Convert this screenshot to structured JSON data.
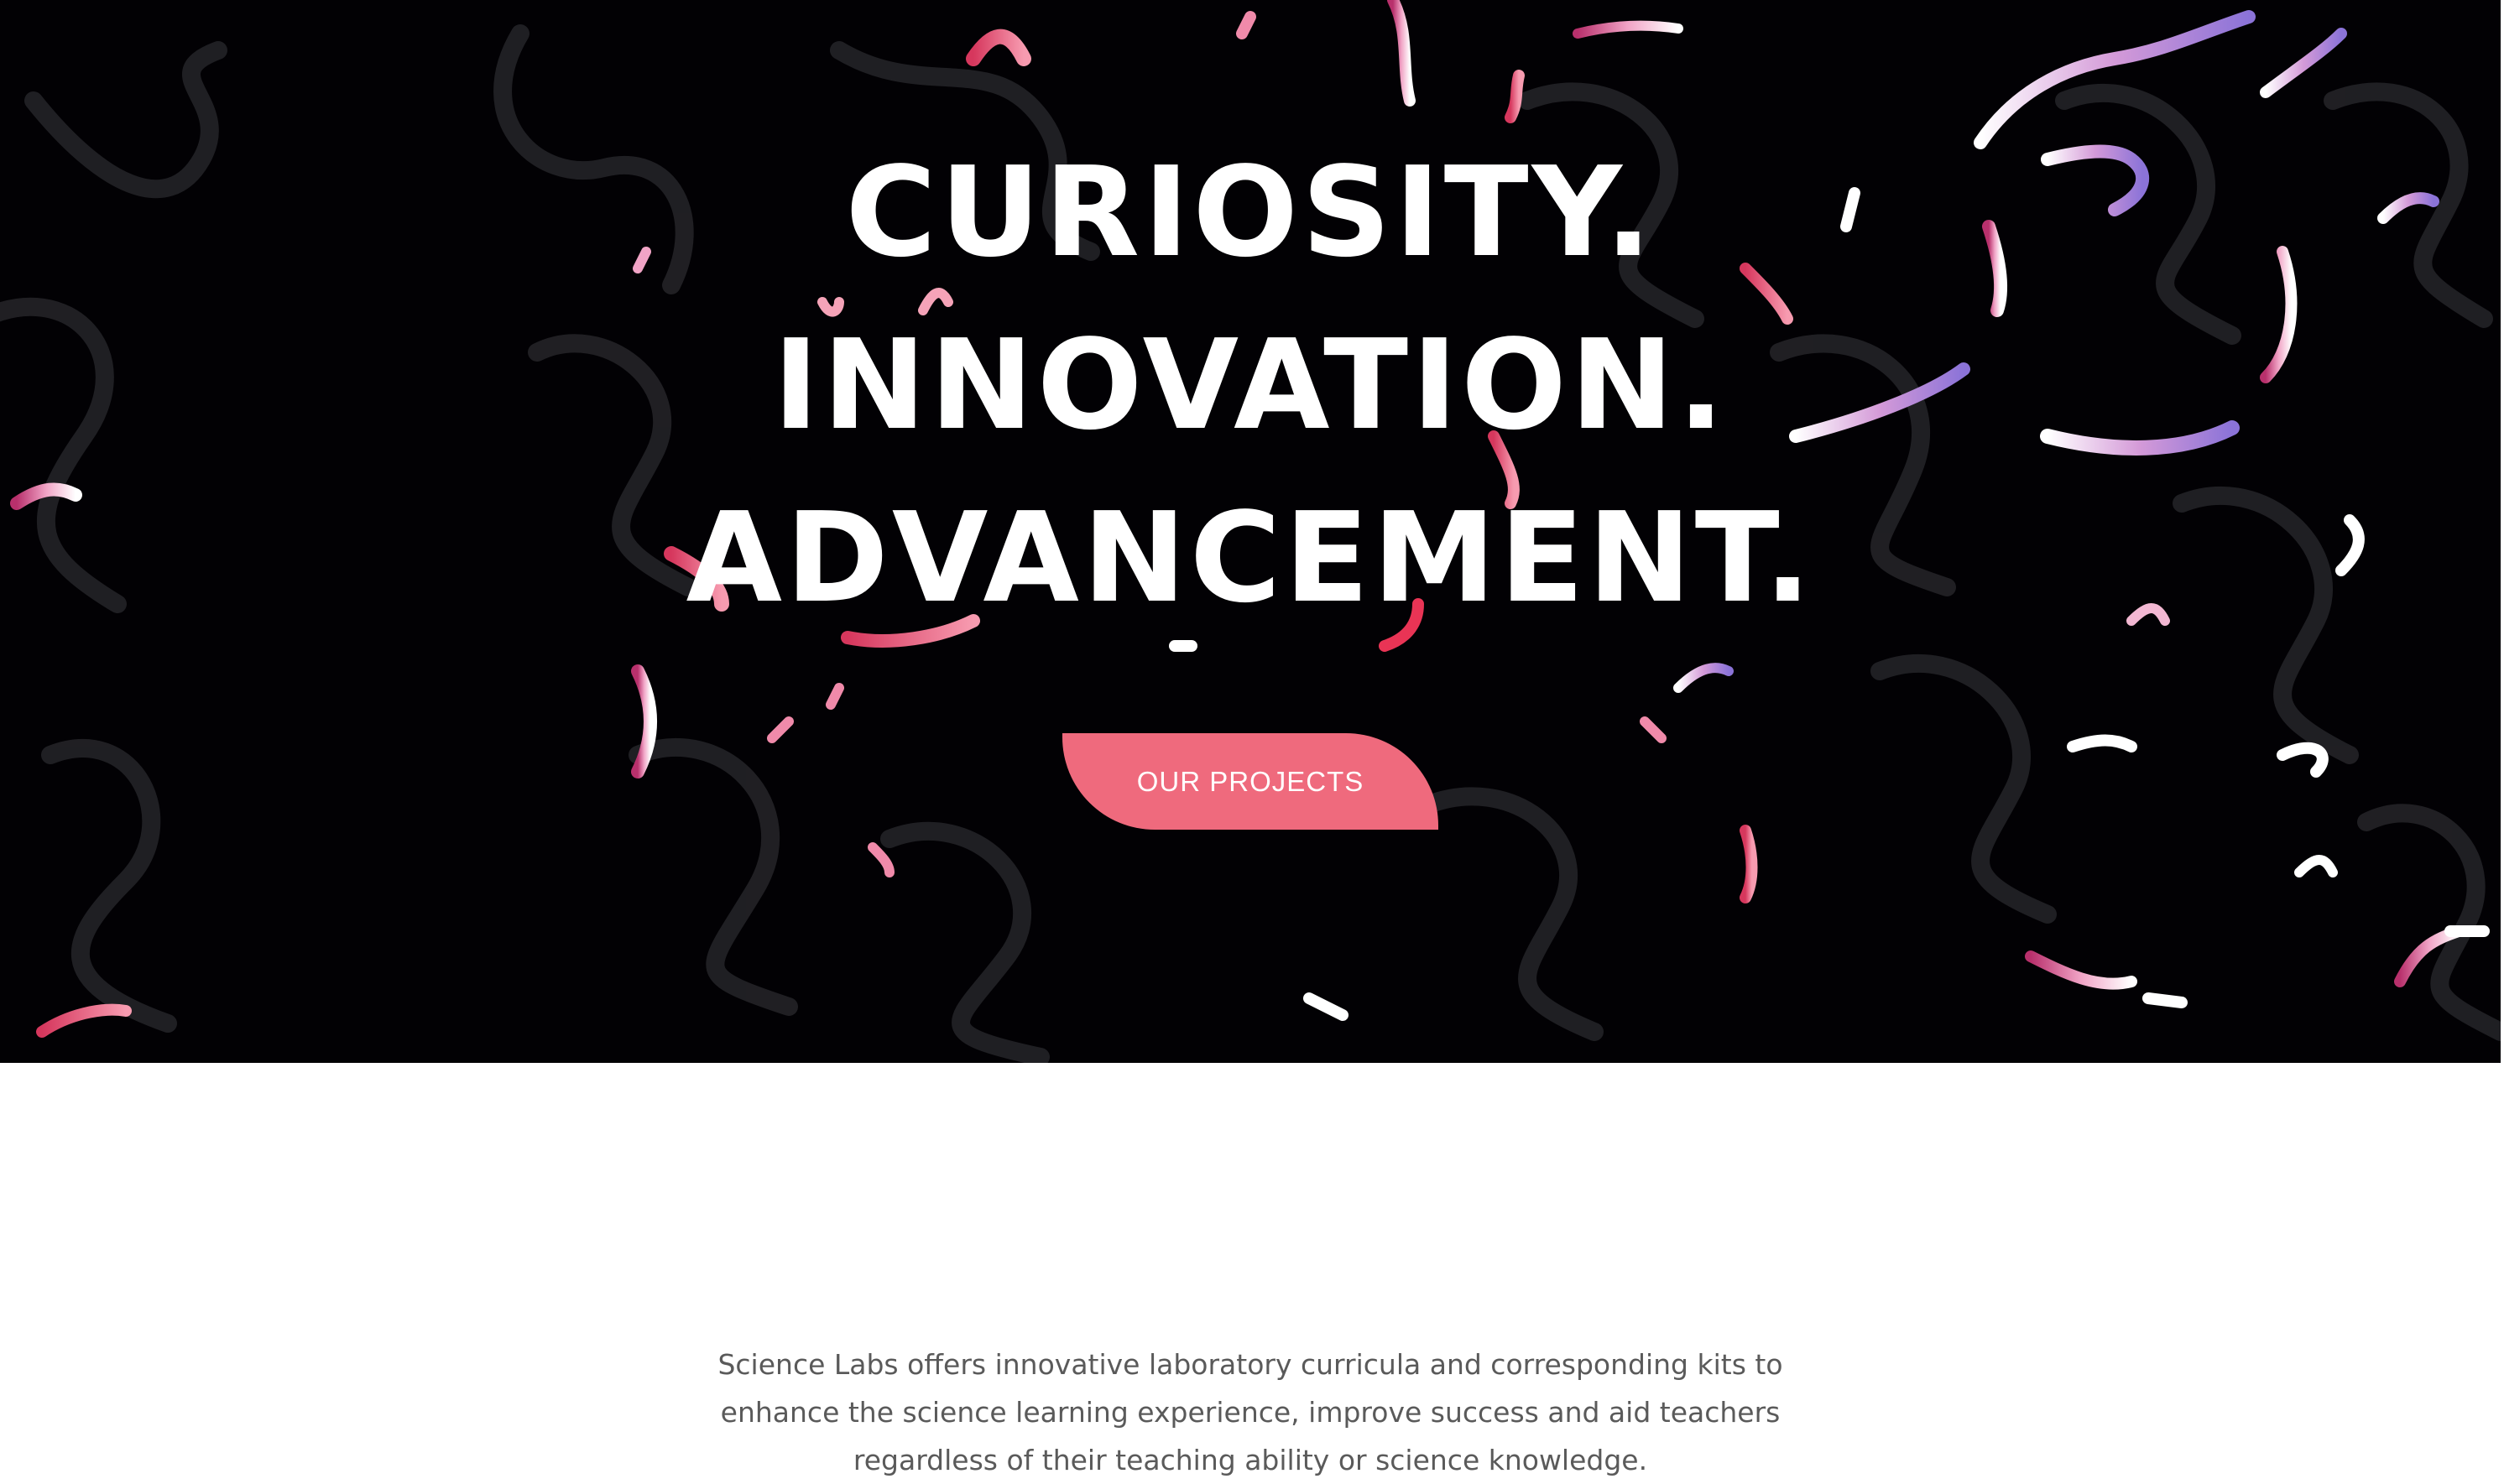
{
  "hero": {
    "headline": [
      "CURIOSITY.",
      "INNOVATION.",
      "ADVANCEMENT."
    ],
    "cta_label": "OUR PROJECTS",
    "background_image": "abstract-ribbons-dark-pattern"
  },
  "intro": {
    "text": "Science Labs offers innovative laboratory curricula and corresponding kits to enhance the science learning experience, improve success and aid teachers regardless of their teaching ability or science knowledge."
  },
  "colors": {
    "hero_background": "#020104",
    "accent": "#ef6a7d",
    "headline": "#ffffff",
    "body_text": "#5a5a5a"
  }
}
